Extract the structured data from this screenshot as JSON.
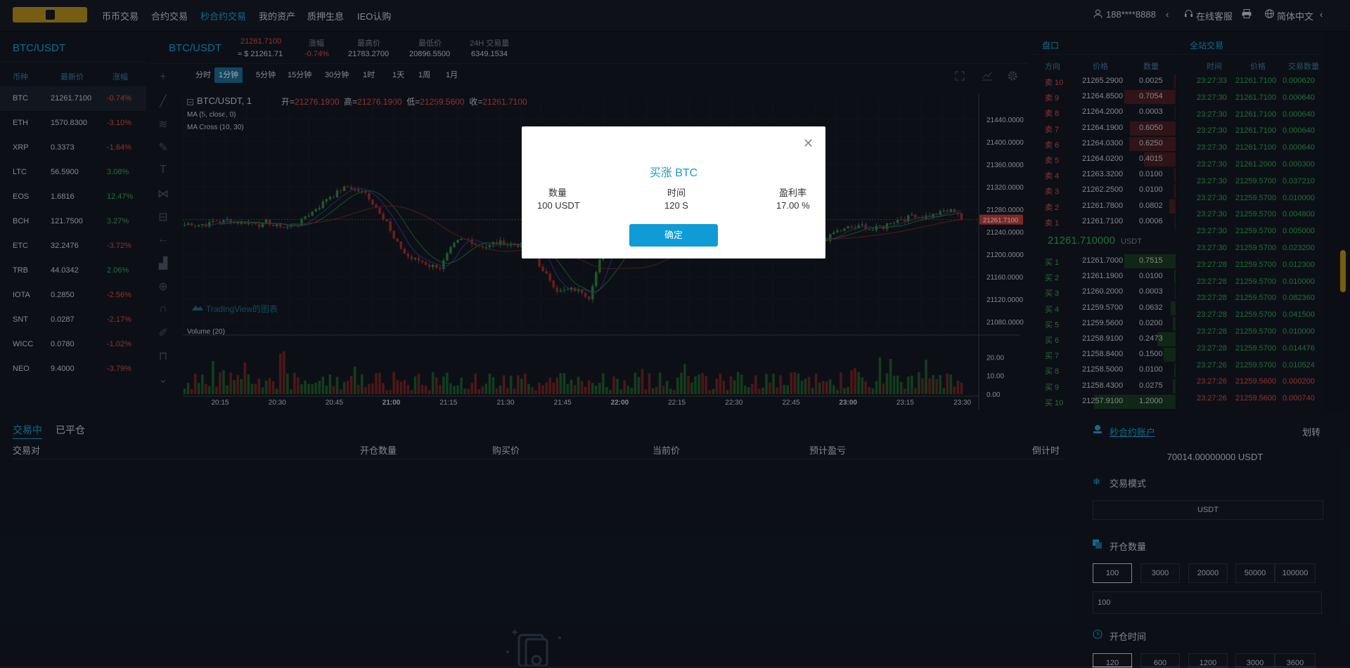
{
  "nav": {
    "items": [
      "币币交易",
      "合约交易",
      "秒合约交易",
      "我的资产",
      "质押生息",
      "IEO认购"
    ],
    "active_index": 2,
    "user": "188****8888",
    "support": "在线客服",
    "language": "简体中文"
  },
  "market_list": {
    "title": "BTC/USDT",
    "headers": [
      "币种",
      "最新价",
      "涨幅"
    ],
    "rows": [
      {
        "coin": "BTC",
        "price": "21261.7100",
        "change": "-0.74%",
        "dir": "down",
        "selected": true
      },
      {
        "coin": "ETH",
        "price": "1570.8300",
        "change": "-3.10%",
        "dir": "down"
      },
      {
        "coin": "XRP",
        "price": "0.3373",
        "change": "-1.64%",
        "dir": "down"
      },
      {
        "coin": "LTC",
        "price": "56.5900",
        "change": "3.08%",
        "dir": "up"
      },
      {
        "coin": "EOS",
        "price": "1.6816",
        "change": "12.47%",
        "dir": "up"
      },
      {
        "coin": "BCH",
        "price": "121.7500",
        "change": "3.27%",
        "dir": "up"
      },
      {
        "coin": "ETC",
        "price": "32.2476",
        "change": "-3.72%",
        "dir": "down"
      },
      {
        "coin": "TRB",
        "price": "44.0342",
        "change": "2.06%",
        "dir": "up"
      },
      {
        "coin": "IOTA",
        "price": "0.2850",
        "change": "-2.56%",
        "dir": "down"
      },
      {
        "coin": "SNT",
        "price": "0.0287",
        "change": "-2.17%",
        "dir": "down"
      },
      {
        "coin": "WICC",
        "price": "0.0780",
        "change": "-1.02%",
        "dir": "down"
      },
      {
        "coin": "NEO",
        "price": "9.4000",
        "change": "-3.79%",
        "dir": "down"
      }
    ]
  },
  "ticker": {
    "pair": "BTC/USDT",
    "price": "21261.7100",
    "price_usd": "≈ $ 21261.71",
    "change_label": "涨幅",
    "change": "-0.74%",
    "high_label": "最高价",
    "high": "21783.2700",
    "low_label": "最低价",
    "low": "20896.5500",
    "vol_label": "24H 交易量",
    "vol": "6349.1534"
  },
  "timeframes": [
    "分时",
    "1分钟",
    "5分钟",
    "15分钟",
    "30分钟",
    "1时",
    "1天",
    "1周",
    "1月"
  ],
  "timeframe_active": 1,
  "chart_legend": {
    "symbol": "BTC/USDT, 1",
    "open_label": "开=",
    "open": "21276.1900",
    "high_label": "高=",
    "high": "21276.1900",
    "low_label": "低=",
    "low": "21259.5600",
    "close_label": "收=",
    "close": "21261.7100",
    "ma": "MA (5, close, 0)",
    "ma_cross": "MA Cross (10, 30)",
    "volume": "Volume (20)",
    "watermark": "TradingView的图表"
  },
  "chart_data": {
    "type": "candlestick",
    "price_ticks": [
      "21440.0000",
      "21400.0000",
      "21360.0000",
      "21320.0000",
      "21280.0000",
      "21240.0000",
      "21200.0000",
      "21160.0000",
      "21120.0000",
      "21080.0000"
    ],
    "price_axis": [
      21060,
      21460
    ],
    "last_price_tag": "21261.7100",
    "volume_ticks": [
      "20.00",
      "10.00",
      "0.00"
    ],
    "volume_axis": [
      0,
      30
    ],
    "time_ticks": [
      "20:15",
      "20:30",
      "20:45",
      "21:00",
      "21:15",
      "21:30",
      "21:45",
      "22:00",
      "22:15",
      "22:30",
      "22:45",
      "23:00",
      "23:15",
      "23:30"
    ]
  },
  "orderbook": {
    "title": "盘口",
    "headers": [
      "方向",
      "价格",
      "数量"
    ],
    "asks": [
      {
        "side": "卖 10",
        "price": "21265.2900",
        "qty": "0.0025",
        "depth": 0.02
      },
      {
        "side": "卖 9",
        "price": "21264.8500",
        "qty": "0.7054",
        "depth": 0.62
      },
      {
        "side": "卖 8",
        "price": "21264.2000",
        "qty": "0.0003",
        "depth": 0.01
      },
      {
        "side": "卖 7",
        "price": "21264.1900",
        "qty": "0.6050",
        "depth": 0.55
      },
      {
        "side": "卖 6",
        "price": "21264.0300",
        "qty": "0.6250",
        "depth": 0.56
      },
      {
        "side": "卖 5",
        "price": "21264.0200",
        "qty": "0.4015",
        "depth": 0.38
      },
      {
        "side": "卖 4",
        "price": "21263.3200",
        "qty": "0.0100",
        "depth": 0.02
      },
      {
        "side": "卖 3",
        "price": "21262.2500",
        "qty": "0.0100",
        "depth": 0.02
      },
      {
        "side": "卖 2",
        "price": "21261.7800",
        "qty": "0.0802",
        "depth": 0.08
      },
      {
        "side": "卖 1",
        "price": "21261.7100",
        "qty": "0.0006",
        "depth": 0.01
      }
    ],
    "last_price": "21261.710000",
    "last_unit": "USDT",
    "bids": [
      {
        "side": "买 1",
        "price": "21261.7000",
        "qty": "0.7515",
        "depth": 0.62
      },
      {
        "side": "买 2",
        "price": "21261.1900",
        "qty": "0.0100",
        "depth": 0.02
      },
      {
        "side": "买 3",
        "price": "21260.2000",
        "qty": "0.0003",
        "depth": 0.01
      },
      {
        "side": "买 4",
        "price": "21259.5700",
        "qty": "0.0632",
        "depth": 0.06
      },
      {
        "side": "买 5",
        "price": "21259.5600",
        "qty": "0.0200",
        "depth": 0.03
      },
      {
        "side": "买 6",
        "price": "21258.9100",
        "qty": "0.2473",
        "depth": 0.22
      },
      {
        "side": "买 7",
        "price": "21258.8400",
        "qty": "0.1500",
        "depth": 0.14
      },
      {
        "side": "买 8",
        "price": "21258.5000",
        "qty": "0.0100",
        "depth": 0.02
      },
      {
        "side": "买 9",
        "price": "21258.4300",
        "qty": "0.0275",
        "depth": 0.03
      },
      {
        "side": "买 10",
        "price": "21257.9100",
        "qty": "1.2000",
        "depth": 0.98
      }
    ]
  },
  "trades": {
    "title": "全站交易",
    "headers": [
      "时间",
      "价格",
      "交易数量"
    ],
    "rows": [
      {
        "time": "23:27:33",
        "price": "21261.7100",
        "qty": "0.000620",
        "dir": "up"
      },
      {
        "time": "23:27:30",
        "price": "21261.7100",
        "qty": "0.000640",
        "dir": "up"
      },
      {
        "time": "23:27:30",
        "price": "21261.7100",
        "qty": "0.000640",
        "dir": "up"
      },
      {
        "time": "23:27:30",
        "price": "21261.7100",
        "qty": "0.000640",
        "dir": "up"
      },
      {
        "time": "23:27:30",
        "price": "21261.7100",
        "qty": "0.000640",
        "dir": "up"
      },
      {
        "time": "23:27:30",
        "price": "21261.2000",
        "qty": "0.000300",
        "dir": "up"
      },
      {
        "time": "23:27:30",
        "price": "21259.5700",
        "qty": "0.037210",
        "dir": "up"
      },
      {
        "time": "23:27:30",
        "price": "21259.5700",
        "qty": "0.010000",
        "dir": "up"
      },
      {
        "time": "23:27:30",
        "price": "21259.5700",
        "qty": "0.004800",
        "dir": "up"
      },
      {
        "time": "23:27:30",
        "price": "21259.5700",
        "qty": "0.005000",
        "dir": "up"
      },
      {
        "time": "23:27:30",
        "price": "21259.5700",
        "qty": "0.023200",
        "dir": "up"
      },
      {
        "time": "23:27:28",
        "price": "21259.5700",
        "qty": "0.012300",
        "dir": "up"
      },
      {
        "time": "23:27:28",
        "price": "21259.5700",
        "qty": "0.010000",
        "dir": "up"
      },
      {
        "time": "23:27:28",
        "price": "21259.5700",
        "qty": "0.082360",
        "dir": "up"
      },
      {
        "time": "23:27:28",
        "price": "21259.5700",
        "qty": "0.041500",
        "dir": "up"
      },
      {
        "time": "23:27:28",
        "price": "21259.5700",
        "qty": "0.010000",
        "dir": "up"
      },
      {
        "time": "23:27:28",
        "price": "21259.5700",
        "qty": "0.014476",
        "dir": "up"
      },
      {
        "time": "23:27:26",
        "price": "21259.5700",
        "qty": "0.010524",
        "dir": "up"
      },
      {
        "time": "23:27:26",
        "price": "21259.5600",
        "qty": "0.000200",
        "dir": "down"
      },
      {
        "time": "23:27:26",
        "price": "21259.5600",
        "qty": "0.000740",
        "dir": "down"
      }
    ]
  },
  "positions": {
    "tabs": [
      "交易中",
      "已平仓"
    ],
    "headers": [
      "交易对",
      "开仓数量",
      "购买价",
      "当前价",
      "预计盈亏",
      "倒计时"
    ]
  },
  "account": {
    "title": "秒合约账户",
    "transfer": "划转",
    "balance": "70014.00000000 USDT",
    "mode_label": "交易模式",
    "mode_value": "USDT",
    "amount_label": "开仓数量",
    "amount_options": [
      "100",
      "3000",
      "20000",
      "50000",
      "100000"
    ],
    "amount_input": "100",
    "time_label": "开仓时间",
    "time_options": [
      "120",
      "600",
      "1200",
      "3000",
      "3600"
    ]
  },
  "modal": {
    "title": "买涨 BTC",
    "qty_label": "数量",
    "qty": "100 USDT",
    "time_label": "时间",
    "time": "120 S",
    "rate_label": "盈利率",
    "rate": "17.00 %",
    "confirm": "确定"
  },
  "colors": {
    "up": "#34a853",
    "down": "#e04a4a",
    "accent": "#1aa3d7",
    "brand": "#b5901d"
  }
}
